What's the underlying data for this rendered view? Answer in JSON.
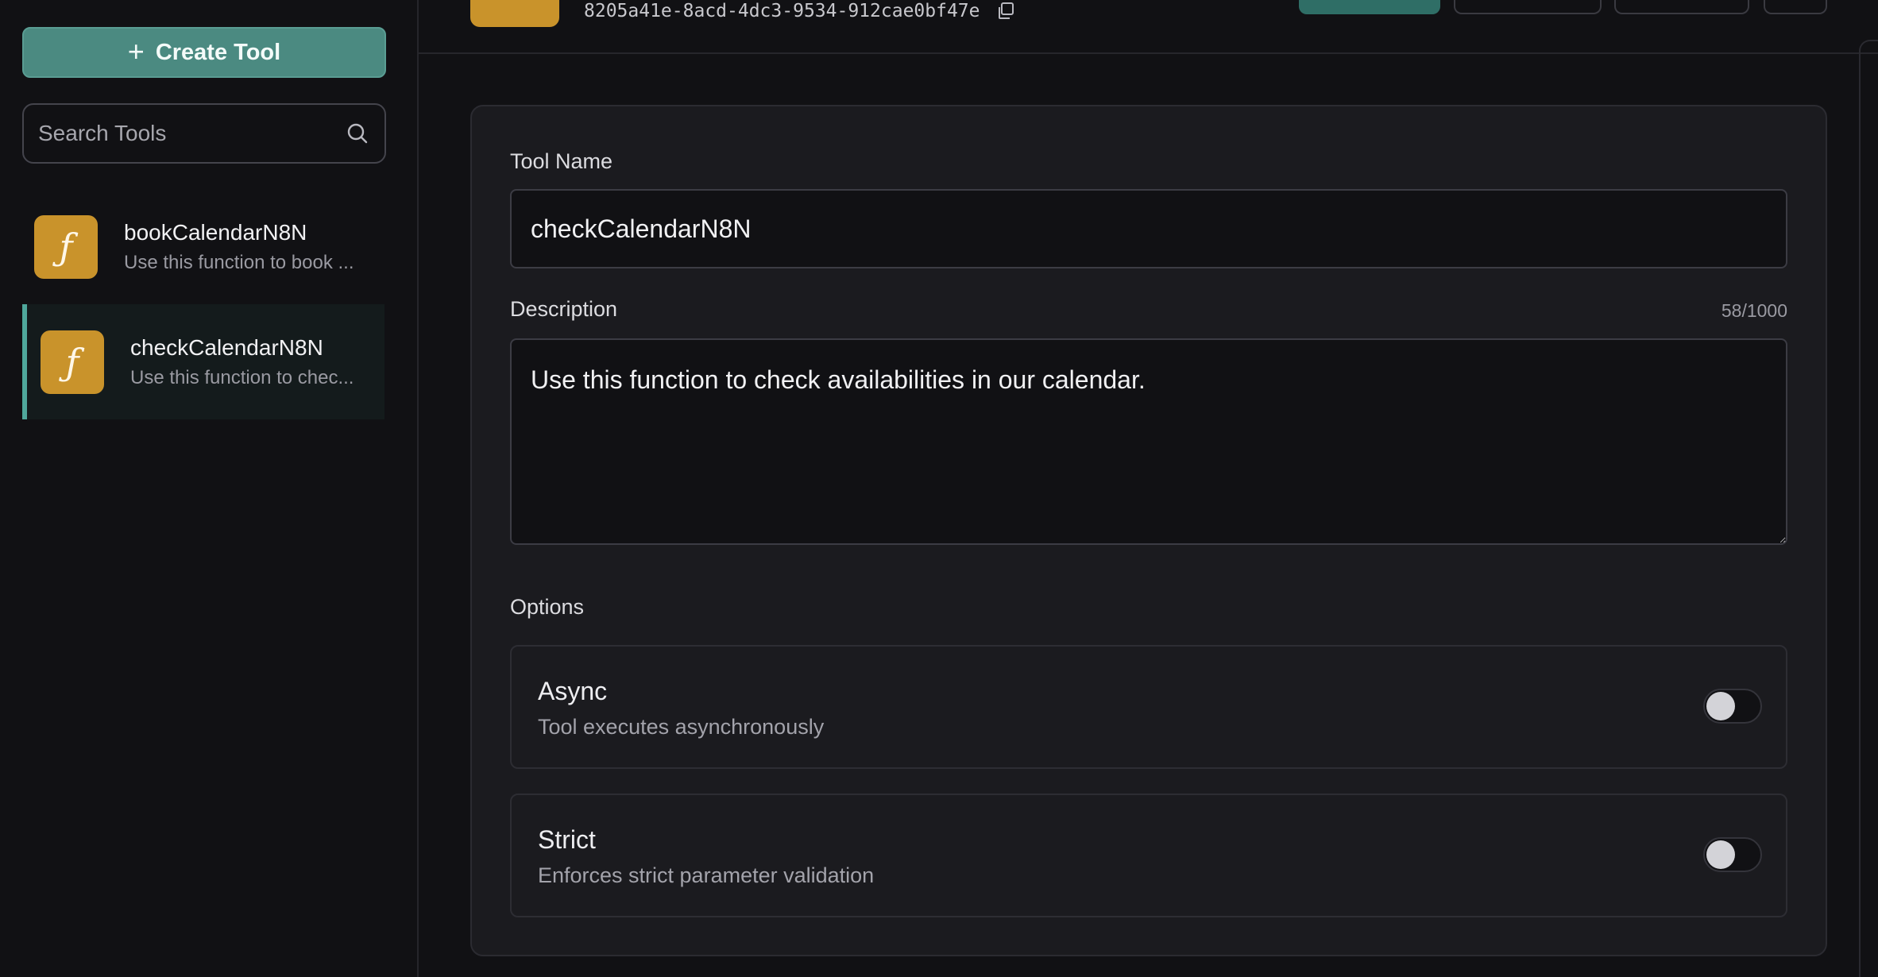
{
  "sidebar": {
    "create_label": "Create Tool",
    "search_placeholder": "Search Tools",
    "items": [
      {
        "title": "bookCalendarN8N",
        "desc": "Use this function to book ...",
        "icon": "function-icon"
      },
      {
        "title": "checkCalendarN8N",
        "desc": "Use this function to chec...",
        "icon": "function-icon",
        "selected": true
      }
    ]
  },
  "header": {
    "tool_id": "8205a41e-8acd-4dc3-9534-912cae0bf47e"
  },
  "form": {
    "name_label": "Tool Name",
    "name_value": "checkCalendarN8N",
    "desc_label": "Description",
    "desc_count": "58/1000",
    "desc_value": "Use this function to check availabilities in our calendar.",
    "options_label": "Options",
    "options": [
      {
        "title": "Async",
        "subtitle": "Tool executes asynchronously",
        "enabled": false
      },
      {
        "title": "Strict",
        "subtitle": "Enforces strict parameter validation",
        "enabled": false
      }
    ]
  },
  "colors": {
    "accent": "#4b8a81",
    "function_icon": "#c9932b",
    "background": "#111114",
    "card": "#1b1b1f"
  }
}
